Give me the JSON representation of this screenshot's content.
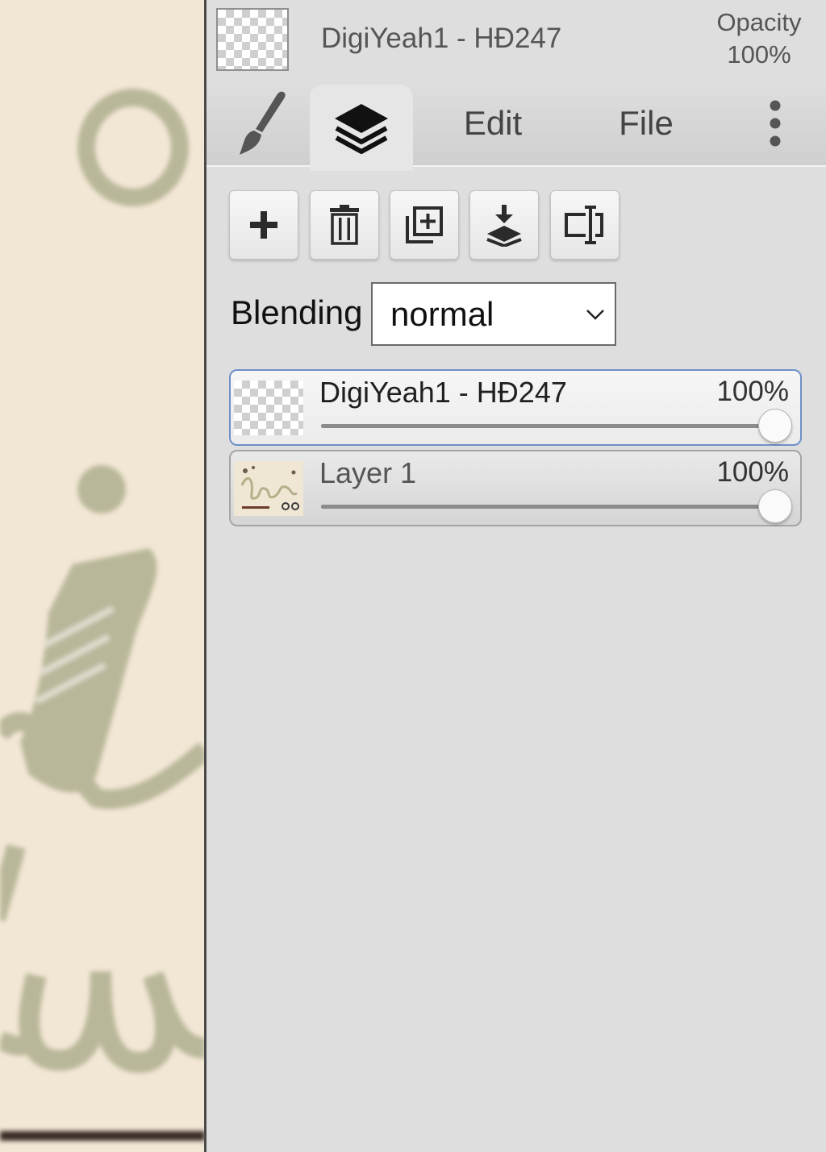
{
  "header": {
    "layer_title": "DigiYeah1 - HĐ247",
    "opacity_label": "Opacity",
    "opacity_value": "100%"
  },
  "tabs": [
    {
      "id": "brush",
      "icon": "paintbrush-icon",
      "label": ""
    },
    {
      "id": "layers",
      "icon": "layers-icon",
      "label": "",
      "active": true
    },
    {
      "id": "edit",
      "label": "Edit"
    },
    {
      "id": "file",
      "label": "File"
    },
    {
      "id": "more",
      "icon": "more-vertical-icon",
      "label": ""
    }
  ],
  "toolbar": [
    {
      "icon": "plus-icon"
    },
    {
      "icon": "trash-icon"
    },
    {
      "icon": "duplicate-layer-icon"
    },
    {
      "icon": "merge-down-icon"
    },
    {
      "icon": "rename-layer-icon"
    }
  ],
  "blending": {
    "label": "Blending",
    "value": "normal"
  },
  "layers": [
    {
      "name": "DigiYeah1 - HĐ247",
      "opacity_label": "100%",
      "opacity": 1.0,
      "selected": true
    },
    {
      "name": "Layer 1",
      "opacity_label": "100%",
      "opacity": 1.0,
      "selected": false
    }
  ],
  "colors": {
    "panel_bg": "#dedede",
    "canvas_bg": "#f2e7d5",
    "ink": "#b9b79a",
    "selected_border": "#6e90c8"
  }
}
